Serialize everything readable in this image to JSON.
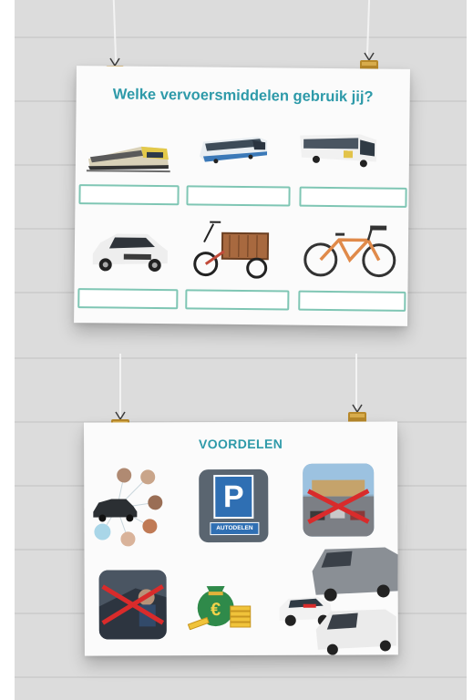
{
  "poster_top": {
    "title": "Welke vervoersmiddelen gebruik jij?",
    "items": [
      {
        "icon": "train-icon"
      },
      {
        "icon": "tram-icon"
      },
      {
        "icon": "bus-icon"
      },
      {
        "icon": "car-icon"
      },
      {
        "icon": "cargo-bike-icon"
      },
      {
        "icon": "bicycle-icon"
      }
    ]
  },
  "poster_bottom": {
    "title": "VOORDELEN",
    "parking_sign_letter": "P",
    "parking_sign_text": "AUTODELEN",
    "money_symbol": "€",
    "items": [
      {
        "icon": "shared-car-network-icon"
      },
      {
        "icon": "parking-sign-icon"
      },
      {
        "icon": "crossed-out-parking-lot-icon"
      },
      {
        "icon": "crossed-out-car-maintenance-icon"
      },
      {
        "icon": "money-bag-icon"
      },
      {
        "icon": "vans-and-car-icon"
      }
    ]
  },
  "colors": {
    "title": "#2e9aa9",
    "answer_box_border": "#7fc6b4",
    "wall": "#dcdcdc",
    "clip_gold": "#b8892a",
    "cross_red": "#d92b2b"
  }
}
